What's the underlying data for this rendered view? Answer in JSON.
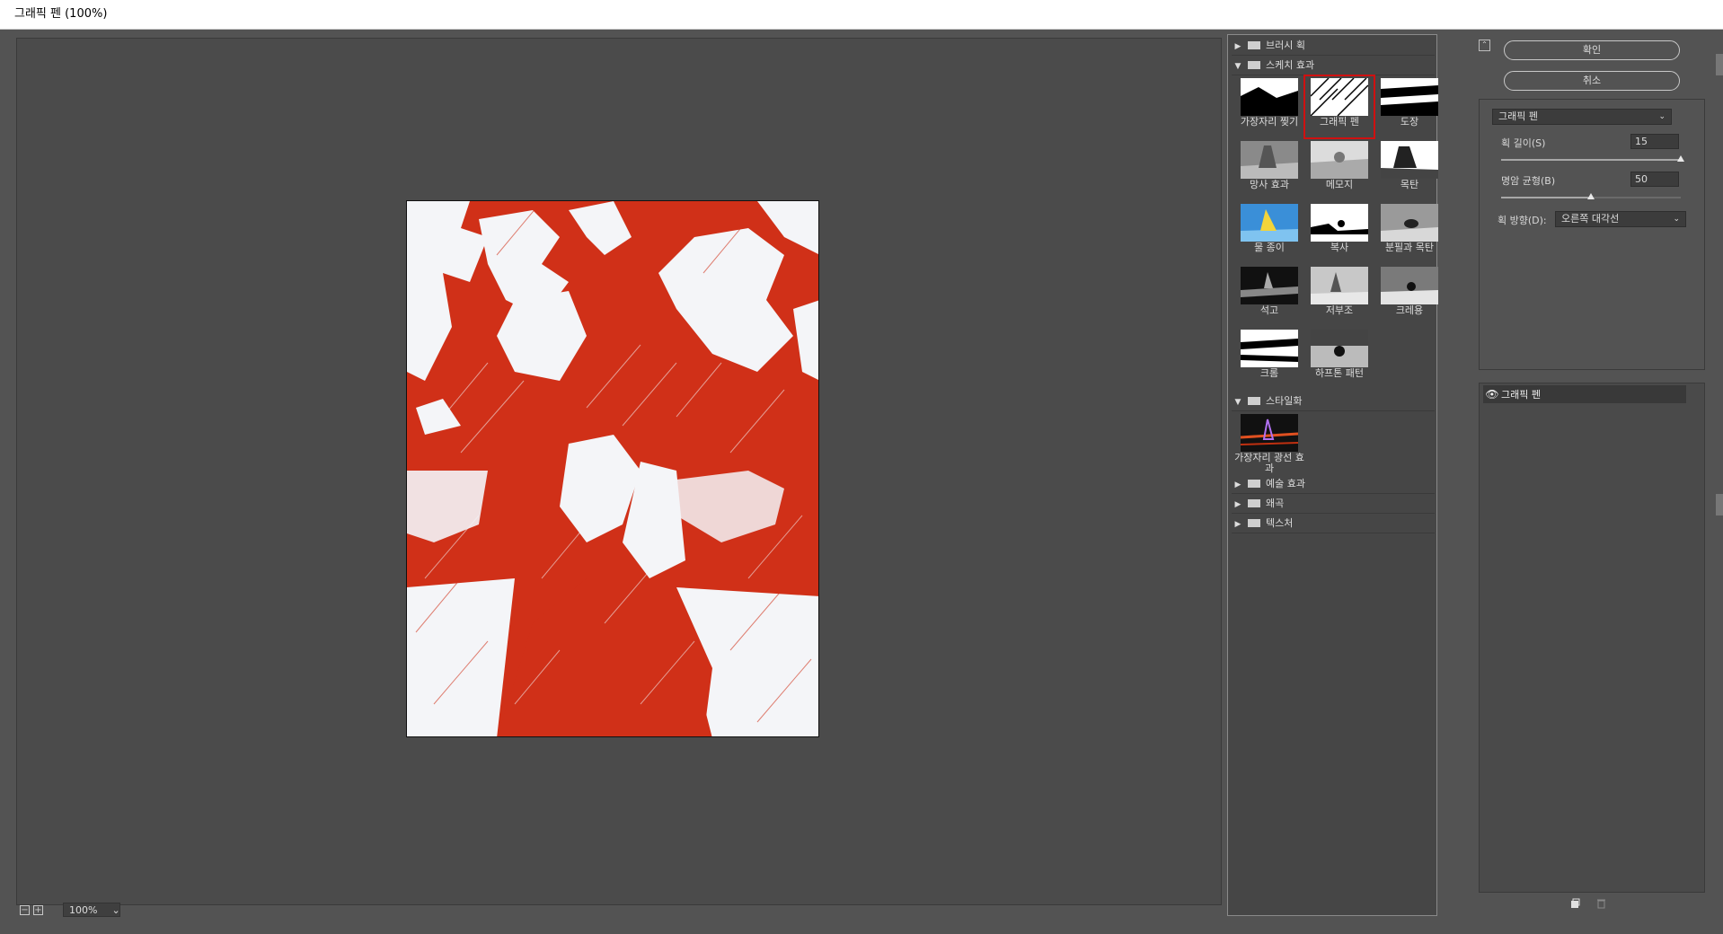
{
  "window": {
    "title": "그래픽 펜 (100%)"
  },
  "zoom": {
    "value": "100%"
  },
  "gallery": {
    "categories": [
      {
        "label": "브러시 획",
        "expanded": false
      },
      {
        "label": "스케치 효과",
        "expanded": true
      },
      {
        "label": "스타일화",
        "expanded": true
      },
      {
        "label": "예술 효과",
        "expanded": false
      },
      {
        "label": "왜곡",
        "expanded": false
      },
      {
        "label": "텍스처",
        "expanded": false
      }
    ],
    "sketch_thumbs": [
      "가장자리 찢기",
      "그래픽 펜",
      "도장",
      "망사 효과",
      "메모지",
      "목탄",
      "물 종이",
      "복사",
      "분필과 목탄",
      "석고",
      "저부조",
      "크레용",
      "크롬",
      "하프톤 패턴"
    ],
    "stylize_thumbs": [
      "가장자리 광선 효과"
    ],
    "selected": "그래픽 펜"
  },
  "buttons": {
    "ok": "확인",
    "cancel": "취소"
  },
  "settings": {
    "filter_select": "그래픽 펜",
    "stroke_length_label": "획 길이(S)",
    "stroke_length_value": "15",
    "stroke_length_fraction": 1.0,
    "balance_label": "명암 균형(B)",
    "balance_value": "50",
    "balance_fraction": 0.5,
    "direction_label": "획 방향(D):",
    "direction_value": "오른쪽 대각선"
  },
  "layers": {
    "items": [
      {
        "label": "그래픽 펜",
        "visible": true
      }
    ]
  },
  "colors": {
    "accent_red": "#d03018",
    "selection_outline": "#d01010",
    "panel_bg": "#464646",
    "canvas_bg": "#4b4b4b"
  },
  "icons": {
    "visibility": "eye-icon",
    "new_layer": "new-layer-icon",
    "delete": "trash-icon",
    "collapse": "collapse-icon"
  }
}
